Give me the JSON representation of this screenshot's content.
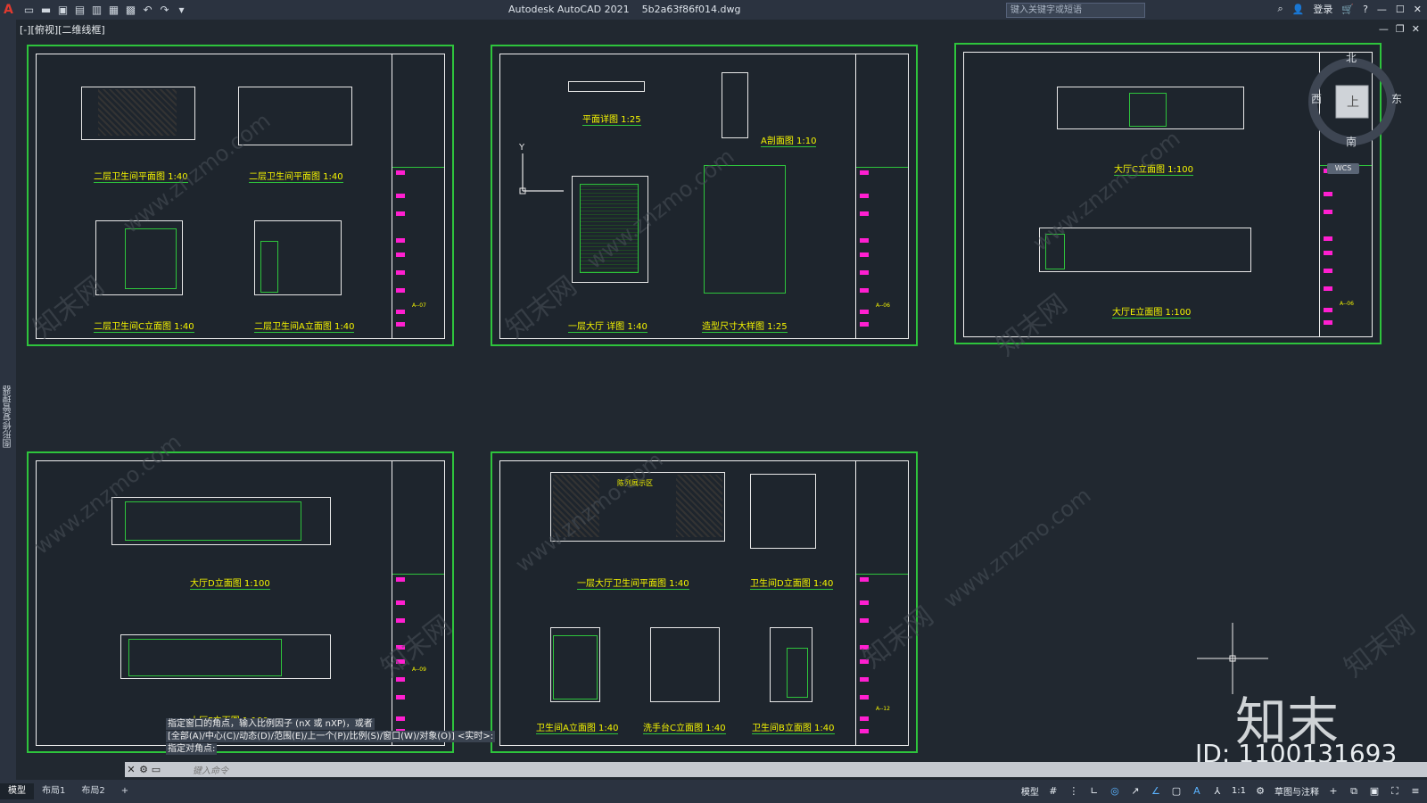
{
  "window": {
    "app_title": "Autodesk AutoCAD 2021",
    "file_name": "5b2a63f86f014.dwg",
    "search_placeholder": "键入关键字或短语",
    "login_label": "登录"
  },
  "viewport": {
    "label": "[-][俯视][二维线框]"
  },
  "side_palette": {
    "label": "图形修复管理器"
  },
  "compass": {
    "north": "北",
    "south": "南",
    "east": "东",
    "west": "西",
    "top": "上",
    "wcs": "WCS"
  },
  "sheets": [
    {
      "labels": [
        "二层卫生间平面图 1:40",
        "二层卫生间平面图 1:40",
        "二层卫生间C立面图 1:40",
        "二层卫生间A立面图 1:40"
      ],
      "sheet_no": "A--07"
    },
    {
      "labels": [
        "平面详图 1:25",
        "A剖面图 1:10",
        "一层大厅 详图 1:40",
        "造型尺寸大样图 1:25"
      ],
      "sheet_no": "A--06"
    },
    {
      "labels": [
        "大厅C立面图 1:100",
        "大厅E立面图 1:100"
      ],
      "sheet_no": "A--06"
    },
    {
      "labels": [
        "大厅D立面图 1:100",
        "大厅F立面图 1:100"
      ],
      "sheet_no": "A--09"
    },
    {
      "labels": [
        "一层大厅卫生间平面图 1:40",
        "卫生间D立面图 1:40",
        "卫生间A立面图 1:40",
        "洗手台C立面图 1:40",
        "卫生间B立面图 1:40"
      ],
      "sheet_no": "A--12",
      "room_tag": "陈列展示区"
    }
  ],
  "command": {
    "history": [
      "指定窗口的角点，输入比例因子 (nX 或 nXP)，或者",
      "[全部(A)/中心(C)/动态(D)/范围(E)/上一个(P)/比例(S)/窗口(W)/对象(O)] <实时>:",
      "指定对角点:"
    ],
    "placeholder": "键入命令"
  },
  "layout_tabs": [
    "模型",
    "布局1",
    "布局2"
  ],
  "status": {
    "model": "模型",
    "scale": "1:1",
    "workspace": "草图与注释"
  },
  "watermark": {
    "brand": "知末",
    "id": "ID: 1100131693",
    "site": "www.znzmo.com",
    "cn": "知末网"
  },
  "colors": {
    "sheet_border": "#2ec43c",
    "text_yellow": "#f5f500",
    "accent_magenta": "#ff1fd0",
    "cyan": "#1fe2e2"
  }
}
